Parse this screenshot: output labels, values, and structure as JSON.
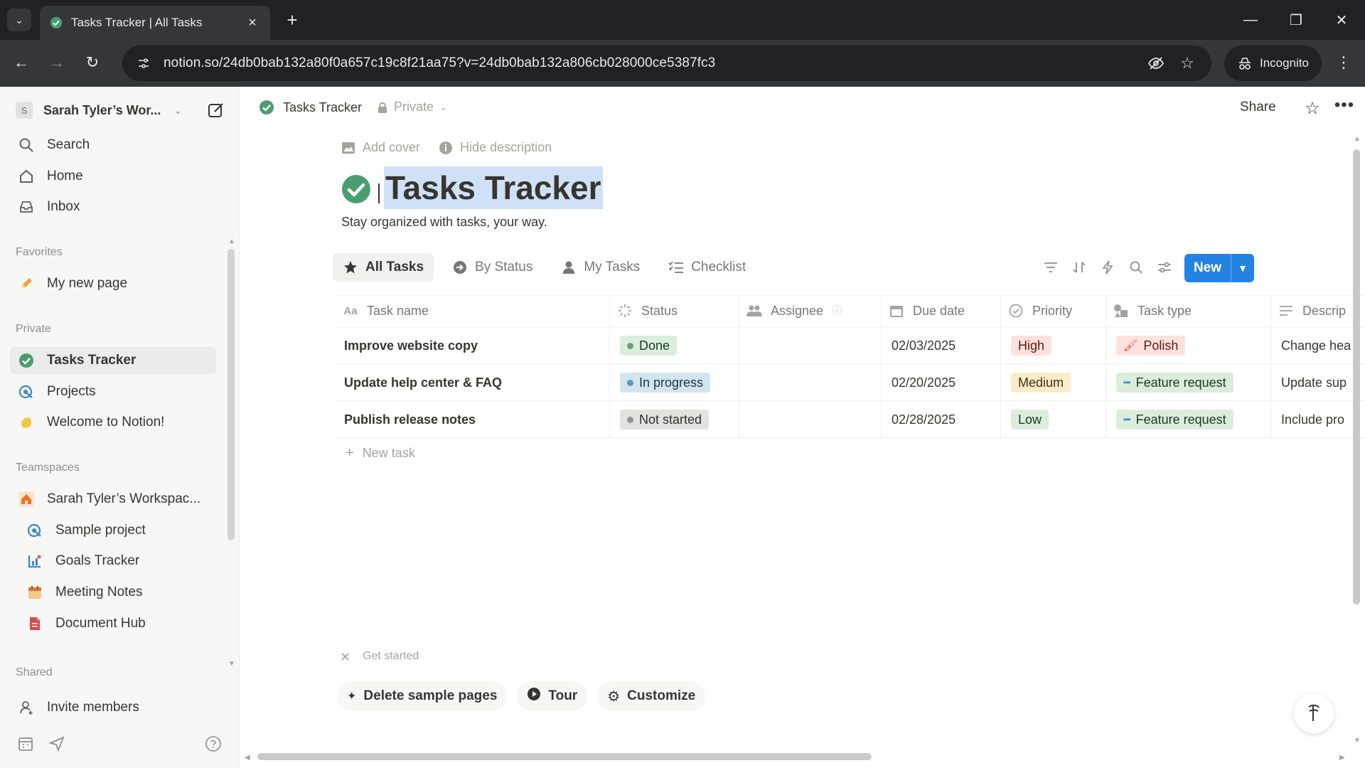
{
  "browser": {
    "tab_title": "Tasks Tracker | All Tasks",
    "url": "notion.so/24db0bab132a80f0a657c19c8f21aa75?v=24db0bab132a806cb028000ce5387fc3",
    "incognito_label": "Incognito"
  },
  "sidebar": {
    "workspace_initial": "S",
    "workspace_name": "Sarah Tyler’s Wor...",
    "top_items": [
      {
        "label": "Search",
        "icon": "search-icon"
      },
      {
        "label": "Home",
        "icon": "home-icon"
      },
      {
        "label": "Inbox",
        "icon": "inbox-icon"
      }
    ],
    "favorites_label": "Favorites",
    "favorites": [
      {
        "label": "My new page",
        "icon": "pencil-icon"
      }
    ],
    "private_label": "Private",
    "private_items": [
      {
        "label": "Tasks Tracker",
        "icon": "check-circle-icon",
        "active": true
      },
      {
        "label": "Projects",
        "icon": "projects-icon"
      },
      {
        "label": "Welcome to Notion!",
        "icon": "wave-icon"
      }
    ],
    "teamspaces_label": "Teamspaces",
    "teamspace_name": "Sarah Tyler’s Workspac...",
    "teamspace_items": [
      {
        "label": "Sample project",
        "icon": "projects-icon"
      },
      {
        "label": "Goals Tracker",
        "icon": "goals-icon"
      },
      {
        "label": "Meeting Notes",
        "icon": "calendar-icon"
      },
      {
        "label": "Document Hub",
        "icon": "document-icon"
      }
    ],
    "shared_label": "Shared",
    "invite_label": "Invite members"
  },
  "topbar": {
    "breadcrumb": "Tasks Tracker",
    "privacy": "Private",
    "share_label": "Share"
  },
  "page": {
    "add_cover": "Add cover",
    "hide_description": "Hide description",
    "title": "Tasks Tracker",
    "description": "Stay organized with tasks, your way.",
    "views": [
      {
        "label": "All Tasks",
        "icon": "star-icon",
        "active": true
      },
      {
        "label": "By Status",
        "icon": "status-circle-icon"
      },
      {
        "label": "My Tasks",
        "icon": "person-icon"
      },
      {
        "label": "Checklist",
        "icon": "checklist-icon"
      }
    ],
    "new_button": "New"
  },
  "table": {
    "columns": [
      "Task name",
      "Status",
      "Assignee",
      "Due date",
      "Priority",
      "Task type",
      "Descrip"
    ],
    "rows": [
      {
        "name": "Improve website copy",
        "status": "Done",
        "assignee": "",
        "due": "02/03/2025",
        "priority": "High",
        "type": "Polish",
        "desc": "Change hea"
      },
      {
        "name": "Update help center & FAQ",
        "status": "In progress",
        "assignee": "",
        "due": "02/20/2025",
        "priority": "Medium",
        "type": "Feature request",
        "desc": "Update sup"
      },
      {
        "name": "Publish release notes",
        "status": "Not started",
        "assignee": "",
        "due": "02/28/2025",
        "priority": "Low",
        "type": "Feature request",
        "desc": "Include pro"
      }
    ],
    "new_task": "New task",
    "colors": {
      "done_bg": "#dbeddb",
      "done_dot": "#6c9b7d",
      "progress_bg": "#d3e5ef",
      "progress_dot": "#5b97bd",
      "notstarted_bg": "#e3e2e0",
      "notstarted_dot": "#91918e",
      "high_bg": "#ffe2dd",
      "medium_bg": "#fdecc8",
      "low_bg": "#dbeddb",
      "polish_bg": "#ffe2dd",
      "feature_bg": "#dbeddb"
    }
  },
  "get_started": {
    "label": "Get started",
    "buttons": [
      "Delete sample pages",
      "Tour",
      "Customize"
    ]
  }
}
